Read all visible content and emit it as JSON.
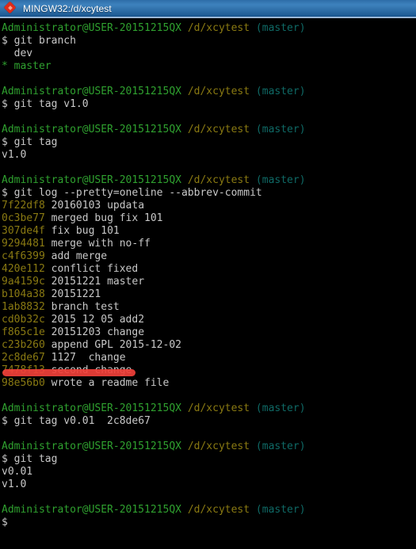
{
  "window": {
    "title": "MINGW32:/d/xcytest",
    "icon": "mingw-diamond-icon"
  },
  "colors": {
    "titlebar_blue": "#2f6fa8",
    "terminal_bg": "#000000",
    "prompt_green": "#2fa12f",
    "path_yellow": "#8a7a12",
    "branch_cyan": "#0f6a66",
    "output_gray": "#c8c8c8",
    "hash_yellow": "#8a7a12",
    "annotation_red": "#f0403a"
  },
  "prompt": {
    "user_host": "Administrator@USER-20151215QX",
    "path": "/d/xcytest",
    "branch": "(master)",
    "sigil": "$"
  },
  "terminal": {
    "blocks": [
      {
        "command": "git branch",
        "output": [
          {
            "text": "  dev",
            "style": "out"
          },
          {
            "text": "* master",
            "style": "star"
          }
        ]
      },
      {
        "command": "git tag v1.0",
        "output": []
      },
      {
        "command": "git tag",
        "output": [
          {
            "text": "v1.0",
            "style": "out"
          }
        ]
      },
      {
        "command": "git log --pretty=oneline --abbrev-commit",
        "output": [
          {
            "hash": "7f22df8",
            "message": "20160103 updata"
          },
          {
            "hash": "0c3be77",
            "message": "merged bug fix 101"
          },
          {
            "hash": "307de4f",
            "message": "fix bug 101"
          },
          {
            "hash": "9294481",
            "message": "merge with no-ff"
          },
          {
            "hash": "c4f6399",
            "message": "add merge"
          },
          {
            "hash": "420e112",
            "message": "conflict fixed"
          },
          {
            "hash": "9a4159c",
            "message": "20151221 master"
          },
          {
            "hash": "b104a38",
            "message": "20151221"
          },
          {
            "hash": "1ab8832",
            "message": "branch test"
          },
          {
            "hash": "cd0b32c",
            "message": "2015 12 05 add2"
          },
          {
            "hash": "f865c1e",
            "message": "20151203 change"
          },
          {
            "hash": "c23b260",
            "message": "append GPL 2015-12-02"
          },
          {
            "hash": "2c8de67",
            "message": "1127  change"
          },
          {
            "hash": "7478f13",
            "message": "second change"
          },
          {
            "hash": "98e56b0",
            "message": "wrote a readme file"
          }
        ]
      },
      {
        "command": "git tag v0.01  2c8de67",
        "output": []
      },
      {
        "command": "git tag",
        "output": [
          {
            "text": "v0.01",
            "style": "out"
          },
          {
            "text": "v1.0",
            "style": "out"
          }
        ]
      },
      {
        "command": "",
        "output": []
      }
    ]
  },
  "annotation": {
    "type": "red-underline",
    "targets_line": "2c8de67 1127  change",
    "color": "#f0403a"
  }
}
